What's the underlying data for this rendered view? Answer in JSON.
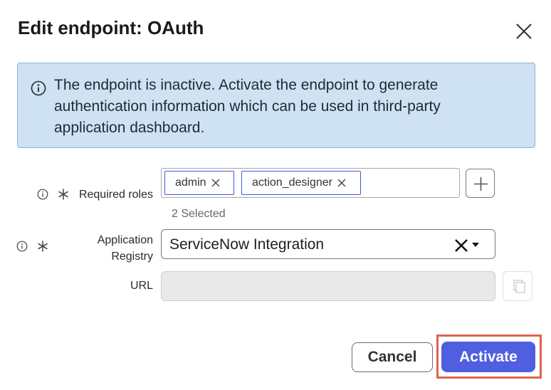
{
  "dialog": {
    "title": "Edit endpoint: OAuth"
  },
  "alert": {
    "message": "The endpoint is inactive. Activate the endpoint to generate authentication information which can be used in third-party application dashboard."
  },
  "form": {
    "required_roles": {
      "label": "Required roles",
      "chips": [
        "admin",
        "action_designer"
      ],
      "selected_text": "2 Selected"
    },
    "application_registry": {
      "label_line1": "Application",
      "label_line2": "Registry",
      "value": "ServiceNow Integration"
    },
    "url": {
      "label": "URL",
      "value": ""
    }
  },
  "footer": {
    "cancel_label": "Cancel",
    "activate_label": "Activate"
  },
  "colors": {
    "alert_bg": "#cfe2f3",
    "alert_border": "#8eb4d8",
    "primary": "#4f5fe0",
    "chip_border": "#4459d8",
    "highlight": "#e0614f"
  },
  "icons": {
    "close": "close-icon",
    "info": "info-icon",
    "required": "asterisk-icon",
    "plus": "plus-icon",
    "clear": "clear-icon",
    "dropdown": "caret-down-icon",
    "copy": "copy-icon"
  }
}
